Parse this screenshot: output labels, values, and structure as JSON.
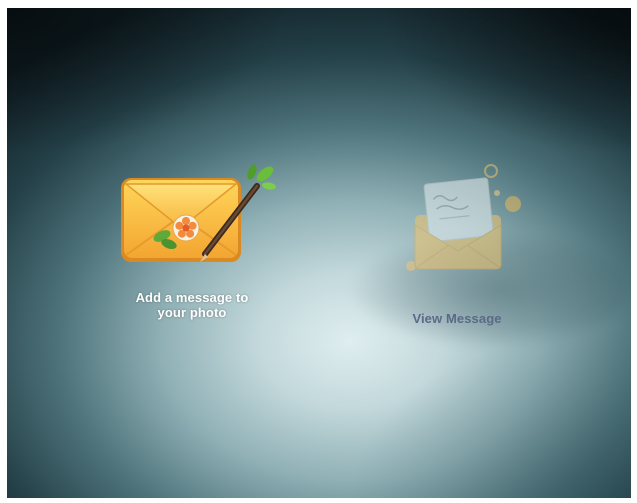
{
  "options": [
    {
      "label": "Add a message to\nyour photo",
      "icon": "envelope-flower-pen-icon",
      "state": "selected"
    },
    {
      "label": "View Message",
      "icon": "open-envelope-letter-icon",
      "state": "dimmed"
    }
  ],
  "colors": {
    "envelope_orange": "#f2a93b",
    "envelope_yellow": "#ffd04a",
    "label_selected": "#ffffff",
    "label_dimmed": "#5b6a86"
  }
}
